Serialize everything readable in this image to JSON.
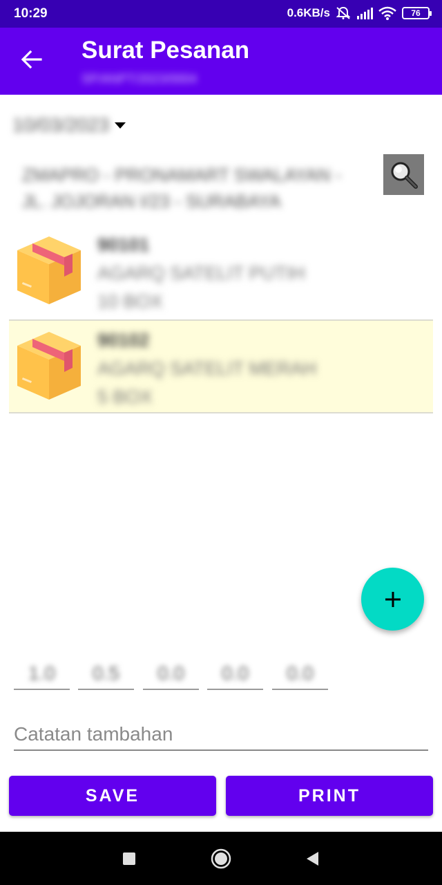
{
  "status_bar": {
    "time": "10:29",
    "network_speed": "0.6KB/s",
    "battery": "76",
    "icons": [
      "mute-icon",
      "signal-icon",
      "wifi-icon",
      "battery-icon"
    ]
  },
  "app_bar": {
    "title": "Surat Pesanan",
    "subtitle": "SP/ANPT/2023/0004"
  },
  "date": "10/03/2023",
  "customer": {
    "line1": "ZMAPRO - PRONAMART SWALAYAN -",
    "line2": "JL. JOJORAN I/23 - SURABAYA"
  },
  "items": [
    {
      "code": "90101",
      "name": "AGARQ SATELIT PUTIH",
      "qty": "10 BOX",
      "highlighted": false
    },
    {
      "code": "90102",
      "name": "AGARQ SATELIT MERAH",
      "qty": "5 BOX",
      "highlighted": true
    }
  ],
  "discounts": [
    "1.0",
    "0.5",
    "0.0",
    "0.0",
    "0.0"
  ],
  "note": {
    "placeholder": "Catatan tambahan",
    "value": ""
  },
  "buttons": {
    "save": "SAVE",
    "print": "PRINT"
  },
  "colors": {
    "status_bar": "#3700b3",
    "primary": "#6200ee",
    "accent": "#03dac5",
    "highlight": "#fffddb"
  }
}
